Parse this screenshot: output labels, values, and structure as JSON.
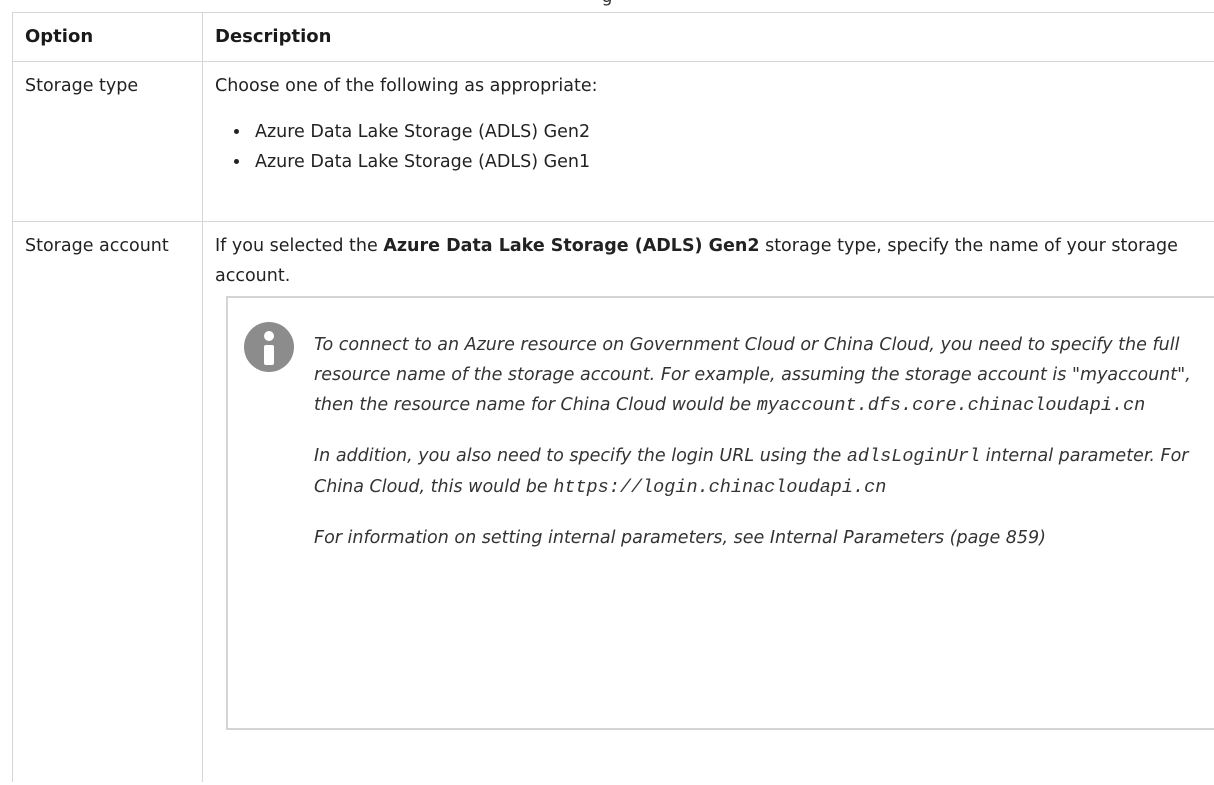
{
  "page_title_fragment": "g",
  "table": {
    "headers": [
      "Option",
      "Description"
    ],
    "rows": [
      {
        "option": "Storage type",
        "intro": "Choose one of the following as appropriate:",
        "choices": [
          "Azure Data Lake Storage (ADLS) Gen2",
          "Azure Data Lake Storage (ADLS) Gen1"
        ]
      },
      {
        "option": "Storage account",
        "desc_prefix": "If you selected the ",
        "desc_bold": "Azure Data Lake Storage (ADLS) Gen2",
        "desc_suffix": " storage type, specify the name of your storage account.",
        "note": {
          "icon": "info-icon",
          "p1_text": "To connect to an Azure resource on Government Cloud or China Cloud, you need to specify the full resource name of the storage account. For example, assuming the storage account is \"myaccount\", then the resource name for China Cloud would be ",
          "p1_code": "myaccount.dfs.core.chinacloudapi.cn",
          "p2_text_a": "In addition, you also need to specify the login URL using the ",
          "p2_code_a": "adlsLoginUrl",
          "p2_text_b": " internal parameter. For China Cloud, this would be ",
          "p2_code_b": "https://login.chinacloudapi.cn",
          "p3_text": "For information on setting internal parameters, see Internal Parameters (page 859)"
        }
      }
    ]
  }
}
